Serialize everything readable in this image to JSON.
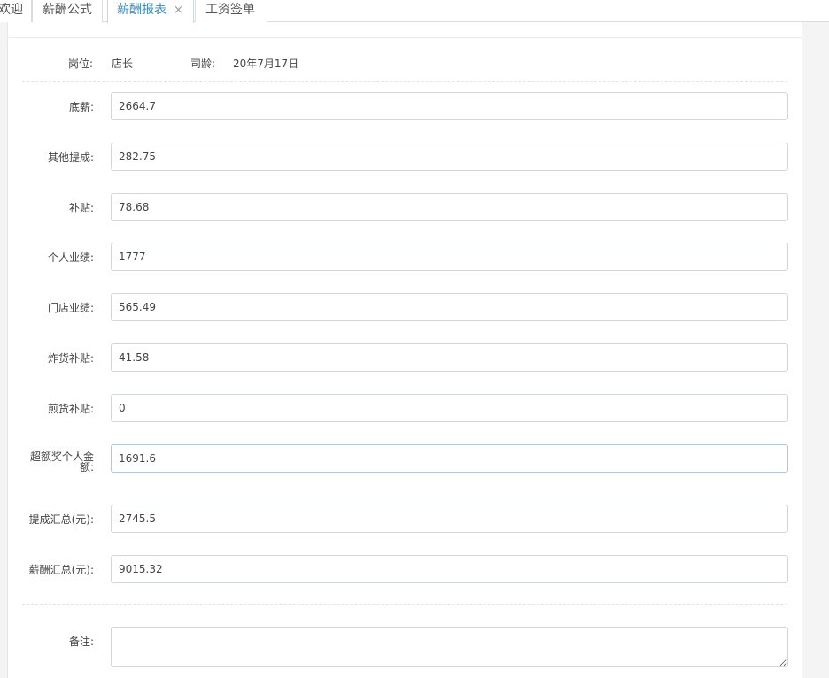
{
  "tabs": [
    {
      "label": "欢迎"
    },
    {
      "label": "薪酬公式"
    },
    {
      "label": "薪酬报表",
      "close": "×"
    },
    {
      "label": "工资签单"
    }
  ],
  "info": {
    "position_label": "岗位:",
    "position_value": "店长",
    "seniority_label": "司龄:",
    "seniority_value": "20年7月17日"
  },
  "fields": [
    {
      "label": "底薪:",
      "value": "2664.7"
    },
    {
      "label": "其他提成:",
      "value": "282.75"
    },
    {
      "label": "补贴:",
      "value": "78.68"
    },
    {
      "label": "个人业绩:",
      "value": "1777"
    },
    {
      "label": "门店业绩:",
      "value": "565.49"
    },
    {
      "label": "炸货补贴:",
      "value": "41.58"
    },
    {
      "label": "煎货补贴:",
      "value": "0"
    },
    {
      "label": "超额奖个人金额:",
      "value": "1691.6"
    },
    {
      "label": "提成汇总(元):",
      "value": "2745.5"
    },
    {
      "label": "薪酬汇总(元):",
      "value": "9015.32"
    }
  ],
  "remark": {
    "label": "备注:",
    "value": ""
  }
}
